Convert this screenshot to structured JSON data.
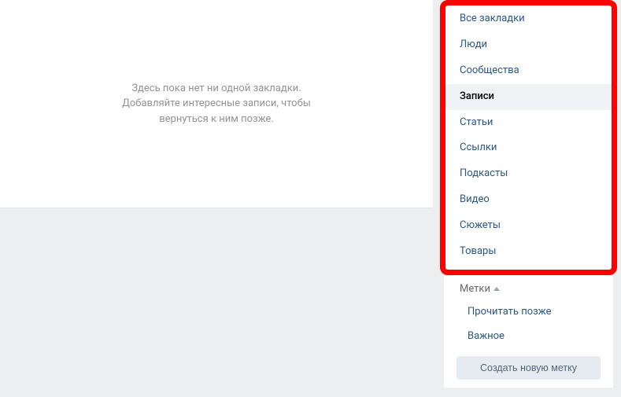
{
  "main": {
    "empty_line1": "Здесь пока нет ни одной закладки.",
    "empty_line2": "Добавляйте интересные записи, чтобы",
    "empty_line3": "вернуться к ним позже."
  },
  "sidebar": {
    "items": [
      {
        "label": "Все закладки",
        "active": false
      },
      {
        "label": "Люди",
        "active": false
      },
      {
        "label": "Сообщества",
        "active": false
      },
      {
        "label": "Записи",
        "active": true
      },
      {
        "label": "Статьи",
        "active": false
      },
      {
        "label": "Ссылки",
        "active": false
      },
      {
        "label": "Подкасты",
        "active": false
      },
      {
        "label": "Видео",
        "active": false
      },
      {
        "label": "Сюжеты",
        "active": false
      },
      {
        "label": "Товары",
        "active": false
      }
    ],
    "tags_header": "Метки",
    "tags": [
      {
        "label": "Прочитать позже"
      },
      {
        "label": "Важное"
      }
    ],
    "create_tag_label": "Создать новую метку"
  }
}
